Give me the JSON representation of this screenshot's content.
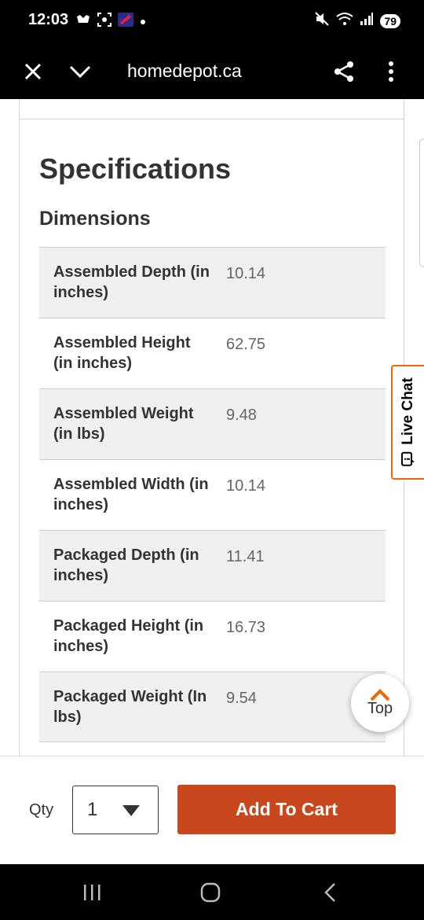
{
  "status": {
    "time": "12:03",
    "battery": "79"
  },
  "browser": {
    "url": "homedepot.ca"
  },
  "specs": {
    "title": "Specifications",
    "section": "Dimensions",
    "rows": [
      {
        "label": "Assembled Depth (in inches)",
        "value": "10.14"
      },
      {
        "label": "Assembled Height (in inches)",
        "value": "62.75"
      },
      {
        "label": "Assembled Weight (in lbs)",
        "value": "9.48"
      },
      {
        "label": "Assembled Width (in inches)",
        "value": "10.14"
      },
      {
        "label": "Packaged Depth (in inches)",
        "value": "11.41"
      },
      {
        "label": "Packaged Height (in inches)",
        "value": "16.73"
      },
      {
        "label": "Packaged Weight (In lbs)",
        "value": "9.54"
      }
    ]
  },
  "live_chat": {
    "label": "Live Chat"
  },
  "top_button": {
    "label": "Top"
  },
  "cart": {
    "qty_label": "Qty",
    "qty_value": "1",
    "add_label": "Add To Cart"
  },
  "colors": {
    "accent": "#f96302",
    "cart_button": "#c9471c"
  }
}
